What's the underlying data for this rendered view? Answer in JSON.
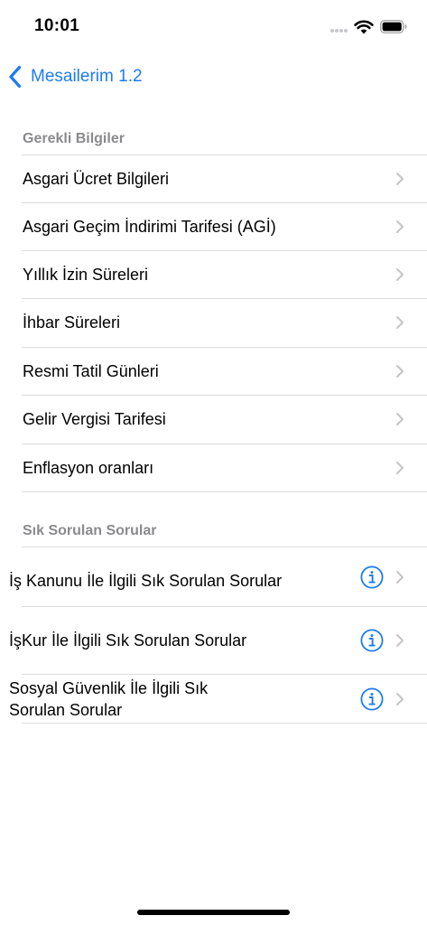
{
  "status_bar": {
    "time": "10:01",
    "signal_icon": "cellular-signal-icon",
    "wifi_icon": "wifi-icon",
    "battery_icon": "battery-icon"
  },
  "nav": {
    "back_label": "Mesailerim 1.2",
    "back_icon": "chevron-back-icon"
  },
  "colors": {
    "accent": "#1c7cf0",
    "section_header": "#8a8a8e",
    "divider": "#dcdcdf",
    "chevron": "#c4c4c7"
  },
  "sections": [
    {
      "title": "Gerekli Bilgiler",
      "items": [
        {
          "label": "Asgari Ücret Bilgileri"
        },
        {
          "label": "Asgari Geçim İndirimi Tarifesi (AGİ)"
        },
        {
          "label": "Yıllık İzin Süreleri"
        },
        {
          "label": "İhbar Süreleri"
        },
        {
          "label": "Resmi Tatil Günleri"
        },
        {
          "label": "Gelir Vergisi Tarifesi"
        },
        {
          "label": "Enflasyon oranları"
        }
      ]
    },
    {
      "title": "Sık Sorulan Sorular",
      "items": [
        {
          "label": "İş Kanunu İle İlgili Sık Sorulan Sorular",
          "info_icon": "info-circle-icon"
        },
        {
          "label": "İşKur İle İlgili Sık Sorulan Sorular",
          "info_icon": "info-circle-icon"
        },
        {
          "label_line1": "Sosyal Güvenlik İle İlgili Sık",
          "label_line2": "Sorulan Sorular",
          "info_icon": "info-circle-icon"
        }
      ]
    }
  ]
}
